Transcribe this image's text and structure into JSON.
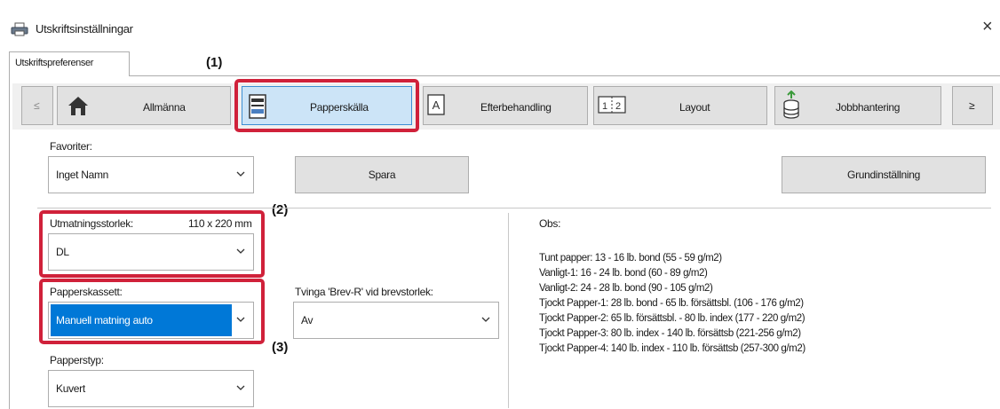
{
  "window": {
    "title": "Utskriftsinställningar",
    "close_glyph": "×"
  },
  "tab": {
    "label": "Utskriftspreferenser"
  },
  "callouts": {
    "c1": "(1)",
    "c2": "(2)",
    "c3": "(3)"
  },
  "nav": {
    "prev": "≤",
    "next": "≥",
    "items": [
      {
        "label": "Allmänna",
        "icon": "house-icon"
      },
      {
        "label": "Papperskälla",
        "icon": "paper-tray-icon",
        "selected": true
      },
      {
        "label": "Efterbehandling",
        "icon": "finishing-icon"
      },
      {
        "label": "Layout",
        "icon": "layout-icon"
      },
      {
        "label": "Jobbhantering",
        "icon": "job-stack-icon"
      }
    ]
  },
  "favorites": {
    "label": "Favoriter:",
    "value": "Inget Namn"
  },
  "buttons": {
    "save": "Spara",
    "defaults": "Grundinställning"
  },
  "output_size": {
    "label": "Utmatningsstorlek:",
    "dimension": "110 x 220 mm",
    "value": "DL"
  },
  "paper_tray": {
    "label": "Papperskassett:",
    "value": "Manuell matning auto"
  },
  "force_letter": {
    "label": "Tvinga 'Brev-R' vid brevstorlek:",
    "value": "Av"
  },
  "paper_type": {
    "label": "Papperstyp:",
    "value": "Kuvert"
  },
  "notes": {
    "title": "Obs:",
    "lines": [
      "Tunt papper: 13 - 16 lb. bond (55 - 59 g/m2)",
      "Vanligt-1: 16 - 24 lb. bond (60 - 89 g/m2)",
      "Vanligt-2: 24 - 28 lb. bond (90 - 105 g/m2)",
      "Tjockt Papper-1: 28 lb. bond - 65 lb. försättsbl. (106 - 176 g/m2)",
      "Tjockt Papper-2: 65 lb. försättsbl. - 80 lb. index (177 - 220 g/m2)",
      "Tjockt Papper-3: 80 lb. index - 140 lb. försättsb (221-256 g/m2)",
      "Tjockt Papper-4: 140 lb. index - 110 lb. försättsb (257-300 g/m2)"
    ]
  },
  "colors": {
    "highlight": "#d0213a",
    "selection": "#0078d7",
    "selected_tab": "#cce4f7"
  }
}
